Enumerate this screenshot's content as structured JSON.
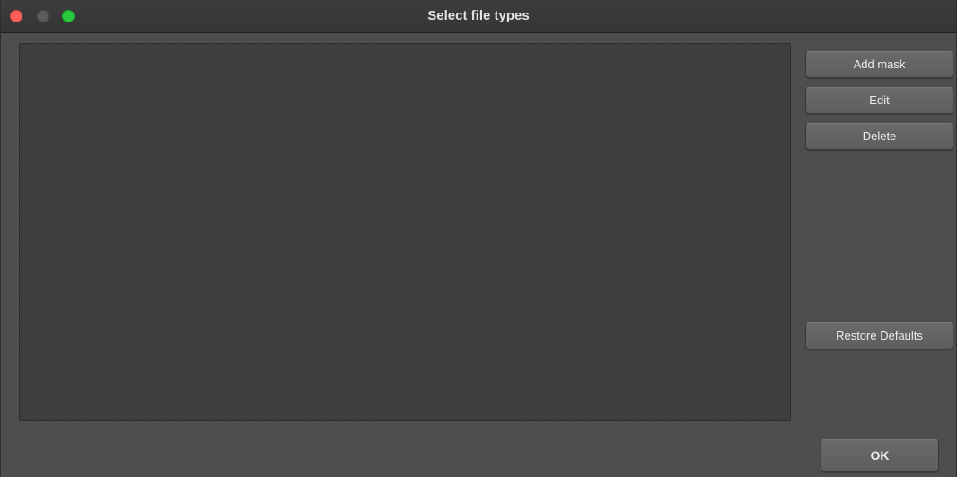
{
  "window": {
    "title": "Select file types"
  },
  "window_controls": {
    "close_icon": "close-icon",
    "minimize_icon": "minimize-icon",
    "zoom_icon": "zoom-icon"
  },
  "file_types_list": {
    "items": []
  },
  "buttons": {
    "add_mask": "Add mask",
    "edit": "Edit",
    "delete": "Delete",
    "restore_defaults": "Restore Defaults",
    "ok": "OK"
  },
  "colors": {
    "close": "#fe5f57",
    "minimize_inactive": "#5b5b5b",
    "zoom": "#28c840"
  }
}
